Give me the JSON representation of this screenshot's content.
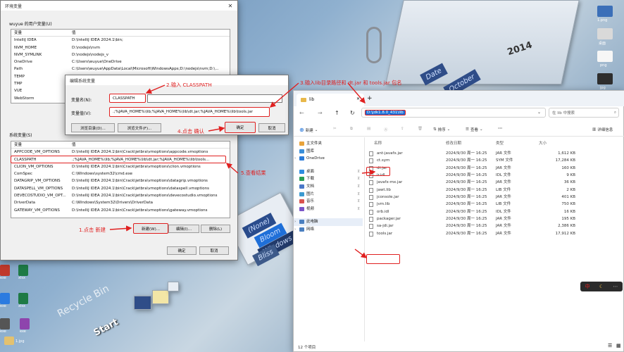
{
  "env_dialog": {
    "title": "环境变量",
    "user_section": "wuyue 的用户变量(U)",
    "col_var": "变量",
    "col_val": "值",
    "user_vars": [
      {
        "name": "IntelliJ IDEA",
        "value": "D:\\IntelliJ IDEA 2024.1\\bin;"
      },
      {
        "name": "NVM_HOME",
        "value": "D:\\nodejs\\nvm"
      },
      {
        "name": "NVM_SYMLINK",
        "value": "D:\\nodejs\\nodejs_v"
      },
      {
        "name": "OneDrive",
        "value": "C:\\Users\\wuyue\\OneDrive"
      },
      {
        "name": "Path",
        "value": "C:\\Users\\wuyue\\AppData\\Local\\Microsoft\\WindowsApps;D:\\nodejs\\nvm;D:\\..."
      },
      {
        "name": "TEMP",
        "value": ""
      },
      {
        "name": "TMP",
        "value": ""
      },
      {
        "name": "VUE",
        "value": ""
      },
      {
        "name": "WebStorm",
        "value": ""
      }
    ],
    "system_section": "系统变量(S)",
    "system_vars": [
      {
        "name": "APPCODE_VM_OPTIONS",
        "value": "D:\\IntelliJ IDEA 2024.1\\bin\\Crack\\jetbra\\vmoptions\\appcode.vmoptions"
      },
      {
        "name": "CLASSPATH",
        "value": ".;%JAVA_HOME%\\lib;%JAVA_HOME%\\lib\\dt.jar;%JAVA_HOME%\\lib\\tools..."
      },
      {
        "name": "CLION_VM_OPTIONS",
        "value": "D:\\IntelliJ IDEA 2024.1\\bin\\Crack\\jetbra\\vmoptions\\clion.vmoptions"
      },
      {
        "name": "ComSpec",
        "value": "C:\\Windows\\system32\\cmd.exe"
      },
      {
        "name": "DATAGRIP_VM_OPTIONS",
        "value": "D:\\IntelliJ IDEA 2024.1\\bin\\Crack\\jetbra\\vmoptions\\datagrip.vmoptions"
      },
      {
        "name": "DATASPELL_VM_OPTIONS",
        "value": "D:\\IntelliJ IDEA 2024.1\\bin\\Crack\\jetbra\\vmoptions\\dataspell.vmoptions"
      },
      {
        "name": "DEVECOSTUDIO_VM_OPT...",
        "value": "D:\\IntelliJ IDEA 2024.1\\bin\\Crack\\jetbra\\vmoptions\\devecostudio.vmoptions"
      },
      {
        "name": "DriverData",
        "value": "C:\\Windows\\System32\\Drivers\\DriverData"
      },
      {
        "name": "GATEWAY_VM_OPTIONS",
        "value": "D:\\IntelliJ IDEA 2024.1\\bin\\Crack\\jetbra\\vmoptions\\gateway.vmoptions"
      }
    ],
    "btn_new": "新建(W)...",
    "btn_edit": "编辑(I)...",
    "btn_delete": "删除(L)",
    "btn_ok": "确定",
    "btn_cancel": "取消"
  },
  "edit_dialog": {
    "title": "编辑系统变量",
    "name_label": "变量名(N):",
    "name_value": "CLASSPATH",
    "value_label": "变量值(V):",
    "value_value": ".;%JAVA_HOME%\\lib;%JAVA_HOME%\\lib\\dt.jar;%JAVA_HOME%\\lib\\tools.jar",
    "btn_browse_dir": "浏览目录(D)...",
    "btn_browse_file": "浏览文件(F)...",
    "btn_ok": "确定",
    "btn_cancel": "取消"
  },
  "annotations": {
    "a1": "1.点击 新建",
    "a2": "2.输入 CLASSPATH",
    "a3": "3.输入lib目录路径和 dt.jar 和 tools.jar 包名",
    "a4": "4.点击 确认",
    "a5": "5.查看结果"
  },
  "explorer": {
    "tab_title": "lib",
    "address": "D:\\jdk1.8.0_431\\lib",
    "search_placeholder": "在 lib 中搜索",
    "toolbar_new": "新建",
    "toolbar_sort": "排序",
    "toolbar_view": "查看",
    "toolbar_more": "···",
    "toolbar_details": "详细信息",
    "col_name": "名称",
    "col_date": "修改日期",
    "col_type": "类型",
    "col_size": "大小",
    "nav": [
      {
        "label": "主文件夹",
        "color": "#e8a33b"
      },
      {
        "label": "图库",
        "color": "#3a8fd9"
      },
      {
        "label": "OneDrive",
        "color": "#2a7bd8"
      },
      {
        "label": "桌面",
        "color": "#2f8de0"
      },
      {
        "label": "下载",
        "color": "#2a9d55"
      },
      {
        "label": "文档",
        "color": "#4a78c8"
      },
      {
        "label": "图片",
        "color": "#3c9ad0"
      },
      {
        "label": "音乐",
        "color": "#d9534f"
      },
      {
        "label": "视频",
        "color": "#7a55c8"
      },
      {
        "label": "此电脑",
        "color": "#4a7fc0"
      },
      {
        "label": "网络",
        "color": "#4a7fc0"
      }
    ],
    "files": [
      {
        "name": "ant-javafx.jar",
        "date": "2024/9/30 周一 16:25",
        "type": "JAR 文件",
        "size": "1,612 KB"
      },
      {
        "name": "ct.sym",
        "date": "2024/9/30 周一 16:25",
        "type": "SYM 文件",
        "size": "17,284 KB"
      },
      {
        "name": "dt.jar",
        "date": "2024/9/30 周一 16:25",
        "type": "JAR 文件",
        "size": "160 KB"
      },
      {
        "name": "ir.idl",
        "date": "2024/9/30 周一 16:25",
        "type": "IDL 文件",
        "size": "9 KB"
      },
      {
        "name": "javafx-mx.jar",
        "date": "2024/9/30 周一 16:25",
        "type": "JAR 文件",
        "size": "36 KB"
      },
      {
        "name": "jawt.lib",
        "date": "2024/9/30 周一 16:25",
        "type": "LIB 文件",
        "size": "2 KB"
      },
      {
        "name": "jconsole.jar",
        "date": "2024/9/30 周一 16:25",
        "type": "JAR 文件",
        "size": "401 KB"
      },
      {
        "name": "jvm.lib",
        "date": "2024/9/30 周一 16:25",
        "type": "LIB 文件",
        "size": "750 KB"
      },
      {
        "name": "orb.idl",
        "date": "2024/9/30 周一 16:25",
        "type": "IDL 文件",
        "size": "16 KB"
      },
      {
        "name": "packager.jar",
        "date": "2024/9/30 周一 16:25",
        "type": "JAR 文件",
        "size": "195 KB"
      },
      {
        "name": "sa-jdi.jar",
        "date": "2024/9/30 周一 16:25",
        "type": "JAR 文件",
        "size": "2,386 KB"
      },
      {
        "name": "tools.jar",
        "date": "2024/9/30 周一 16:25",
        "type": "JAR 文件",
        "size": "17,912 KB"
      }
    ],
    "status": "12 个项目"
  },
  "desktop": {
    "deco_words": [
      "October",
      "2014",
      "Date",
      "(None)",
      "Bloom",
      "Windows",
      "Bliss",
      "Start",
      "Recycle Bin"
    ],
    "icons_right": [
      "1.png",
      "桌面",
      "png",
      "jpg",
      "txt"
    ],
    "icons_left": [
      "exe",
      "xlsx",
      "xlsx",
      "exe",
      "exe",
      "exe",
      "1.jpg"
    ],
    "tray": [
      "中",
      "☾",
      "⋯"
    ]
  }
}
